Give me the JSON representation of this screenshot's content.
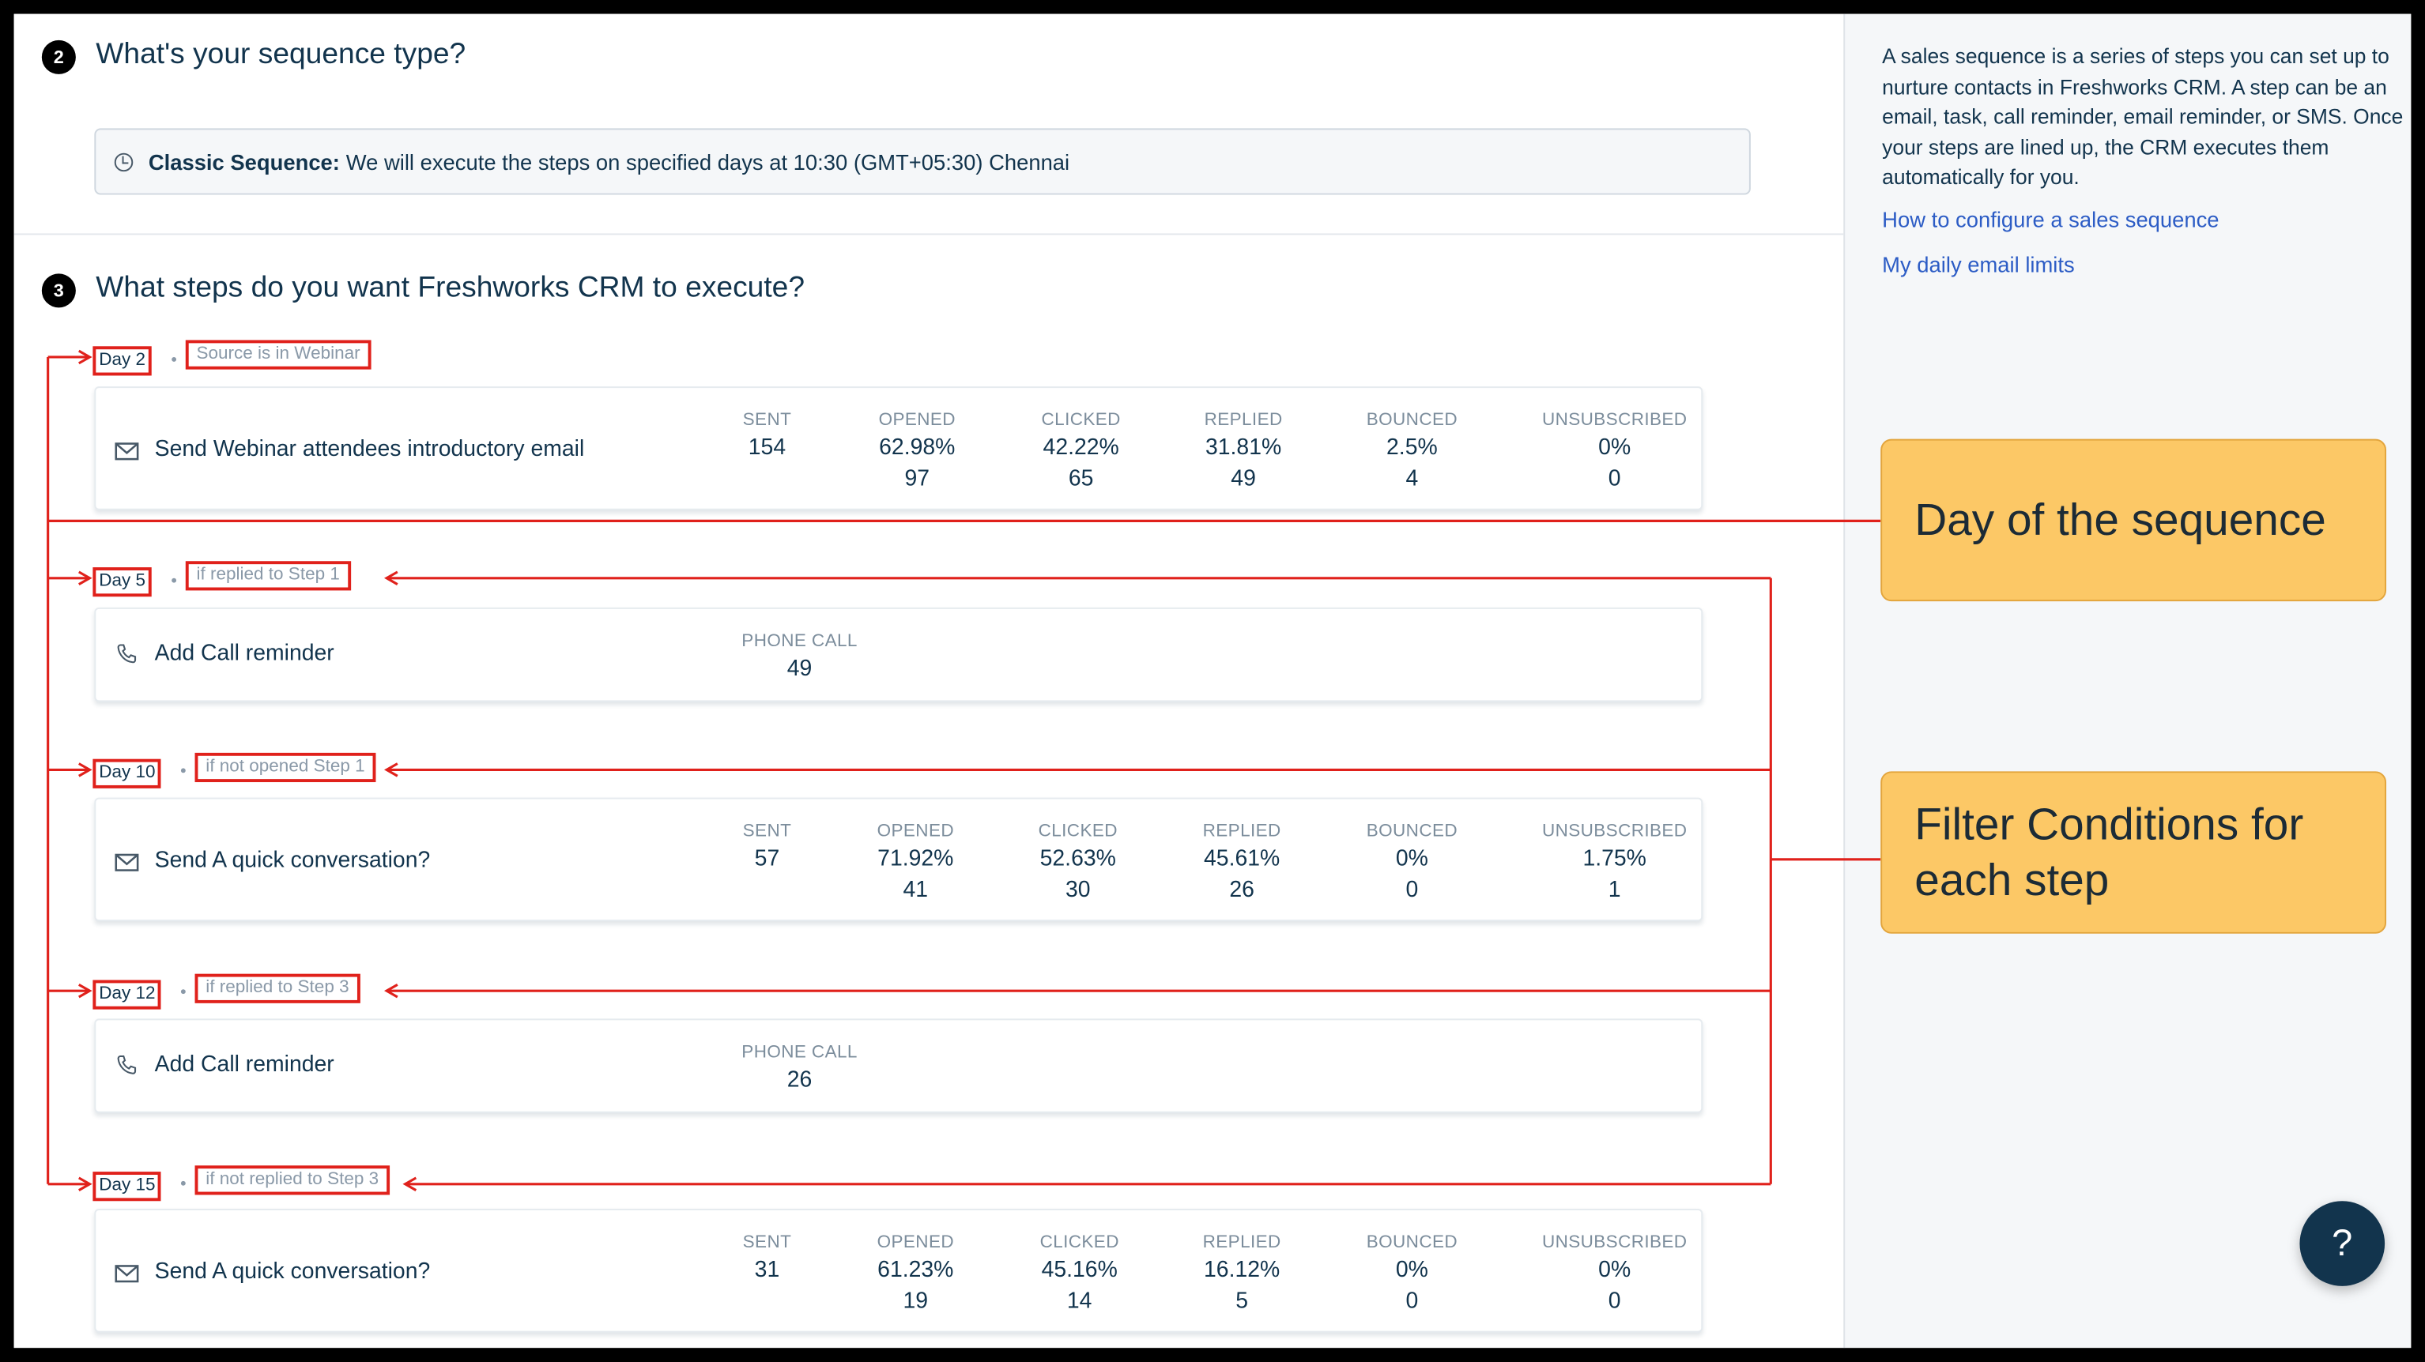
{
  "section2": {
    "number": "2",
    "title": "What's your sequence type?"
  },
  "sequence": {
    "type_label": "Classic Sequence:",
    "description": "We will execute the steps on specified days at 10:30 (GMT+05:30) Chennai"
  },
  "section3": {
    "number": "3",
    "title": "What steps do you want Freshworks CRM to execute?"
  },
  "steps": [
    {
      "day": "Day 2",
      "condition": "Source is in Webinar",
      "icon": "mail-icon",
      "action": "Send",
      "name": "Webinar attendees introductory email",
      "stats": [
        {
          "label": "SENT",
          "v1": "154",
          "v2": ""
        },
        {
          "label": "OPENED",
          "v1": "62.98%",
          "v2": "97"
        },
        {
          "label": "CLICKED",
          "v1": "42.22%",
          "v2": "65"
        },
        {
          "label": "REPLIED",
          "v1": "31.81%",
          "v2": "49"
        },
        {
          "label": "BOUNCED",
          "v1": "2.5%",
          "v2": "4"
        },
        {
          "label": "UNSUBSCRIBED",
          "v1": "0%",
          "v2": "0"
        }
      ]
    },
    {
      "day": "Day 5",
      "condition": "if replied to Step 1",
      "icon": "phone-icon",
      "action": "Add",
      "name": "Call reminder",
      "stats": [
        {
          "label": "PHONE CALL",
          "v1": "49",
          "v2": ""
        }
      ]
    },
    {
      "day": "Day 10",
      "condition": "if not opened Step 1",
      "icon": "mail-icon",
      "action": "Send",
      "name": "A quick conversation?",
      "stats": [
        {
          "label": "SENT",
          "v1": "57",
          "v2": ""
        },
        {
          "label": "OPENED",
          "v1": "71.92%",
          "v2": "41"
        },
        {
          "label": "CLICKED",
          "v1": "52.63%",
          "v2": "30"
        },
        {
          "label": "REPLIED",
          "v1": "45.61%",
          "v2": "26"
        },
        {
          "label": "BOUNCED",
          "v1": "0%",
          "v2": "0"
        },
        {
          "label": "UNSUBSCRIBED",
          "v1": "1.75%",
          "v2": "1"
        }
      ]
    },
    {
      "day": "Day 12",
      "condition": "if replied to Step 3",
      "icon": "phone-icon",
      "action": "Add",
      "name": "Call reminder",
      "stats": [
        {
          "label": "PHONE CALL",
          "v1": "26",
          "v2": ""
        }
      ]
    },
    {
      "day": "Day 15",
      "condition": "if not replied to Step 3",
      "icon": "mail-icon",
      "action": "Send",
      "name": "A quick conversation?",
      "stats": [
        {
          "label": "SENT",
          "v1": "31",
          "v2": ""
        },
        {
          "label": "OPENED",
          "v1": "61.23%",
          "v2": "19"
        },
        {
          "label": "CLICKED",
          "v1": "45.16%",
          "v2": "14"
        },
        {
          "label": "REPLIED",
          "v1": "16.12%",
          "v2": "5"
        },
        {
          "label": "BOUNCED",
          "v1": "0%",
          "v2": "0"
        },
        {
          "label": "UNSUBSCRIBED",
          "v1": "0%",
          "v2": "0"
        }
      ]
    }
  ],
  "sidebar": {
    "description": "A sales sequence is a series of steps you can set up to nurture contacts in Freshworks CRM. A step can be an email, task, call reminder, email reminder, or SMS. Once your steps are lined up, the CRM executes them automatically for you.",
    "links": [
      "How to configure a sales sequence",
      "My daily email limits"
    ]
  },
  "callouts": {
    "day": "Day of the sequence",
    "filter": "Filter Conditions for each step"
  },
  "help": {
    "label": "?"
  },
  "colors": {
    "annotation": "#e0211b",
    "callout": "#fcc866",
    "link": "#2c5cc5",
    "text": "#12344d"
  }
}
